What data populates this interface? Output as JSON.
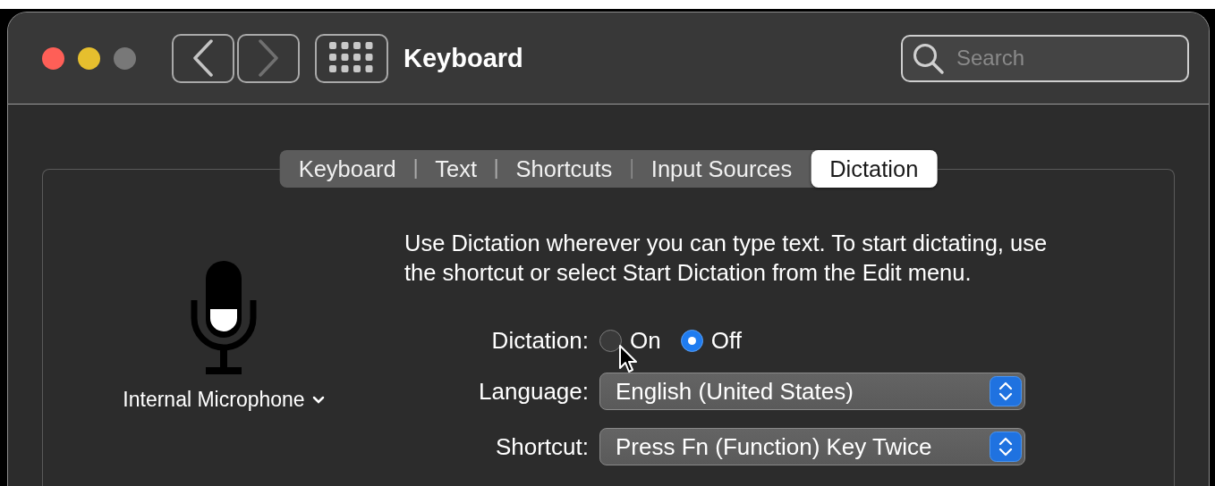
{
  "window": {
    "title": "Keyboard"
  },
  "nav_buttons": [
    {
      "kind": "back",
      "disabled": false
    },
    {
      "kind": "forward",
      "disabled": true
    }
  ],
  "search": {
    "placeholder": "Search"
  },
  "tabs": [
    {
      "label": "Keyboard",
      "selected": false
    },
    {
      "label": "Text",
      "selected": false
    },
    {
      "label": "Shortcuts",
      "selected": false
    },
    {
      "label": "Input Sources",
      "selected": false
    },
    {
      "label": "Dictation",
      "selected": true
    }
  ],
  "microphone": {
    "label": "Internal Microphone"
  },
  "description": "Use Dictation wherever you can type text. To start dictating, use the shortcut or select Start Dictation from the Edit menu.",
  "dictation": {
    "label": "Dictation:",
    "options": [
      {
        "label": "On",
        "selected": false
      },
      {
        "label": "Off",
        "selected": true
      }
    ]
  },
  "popups": [
    {
      "label": "Language:",
      "value": "English (United States)"
    },
    {
      "label": "Shortcut:",
      "value": "Press Fn (Function) Key Twice"
    }
  ]
}
